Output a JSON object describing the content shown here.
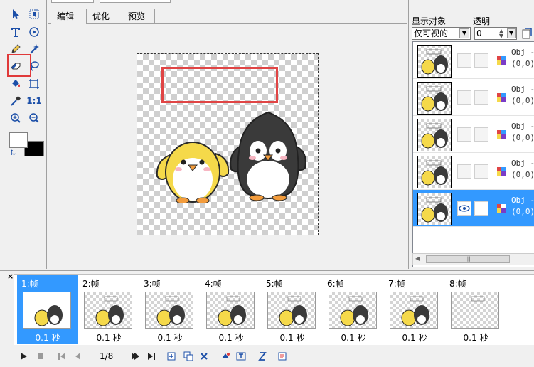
{
  "tabs": [
    {
      "label": "编辑"
    },
    {
      "label": "优化"
    },
    {
      "label": "预览"
    }
  ],
  "right_panel": {
    "show_objects_label": "显示对象",
    "opacity_label": "透明",
    "show_select_value": "仅可视的",
    "opacity_value": "0",
    "layers": [
      {
        "name": "Obj -",
        "pos": "(0,0)",
        "visible": false,
        "selected": false
      },
      {
        "name": "Obj -",
        "pos": "(0,0)",
        "visible": false,
        "selected": false
      },
      {
        "name": "Obj -",
        "pos": "(0,0)",
        "visible": false,
        "selected": false
      },
      {
        "name": "Obj -",
        "pos": "(0,0)",
        "visible": false,
        "selected": false
      },
      {
        "name": "Obj -",
        "pos": "(0,0)",
        "visible": true,
        "selected": true
      }
    ]
  },
  "frames": [
    {
      "label": "1:帧",
      "time": "0.1 秒",
      "selected": true
    },
    {
      "label": "2:帧",
      "time": "0.1 秒",
      "selected": false
    },
    {
      "label": "3:帧",
      "time": "0.1 秒",
      "selected": false
    },
    {
      "label": "4:帧",
      "time": "0.1 秒",
      "selected": false
    },
    {
      "label": "5:帧",
      "time": "0.1 秒",
      "selected": false
    },
    {
      "label": "6:帧",
      "time": "0.1 秒",
      "selected": false
    },
    {
      "label": "7:帧",
      "time": "0.1 秒",
      "selected": false
    },
    {
      "label": "8:帧",
      "time": "0.1 秒",
      "selected": false
    }
  ],
  "frames_close_label": "×",
  "playbar": {
    "frame_counter": "1/8"
  },
  "tools": {
    "actual_size_label": "1:1"
  },
  "colors": {
    "selection_blue": "#3399ff",
    "highlight_red": "#e03a3a",
    "penguin_yellow": "#f5d94a",
    "penguin_dark": "#3a3a3a"
  }
}
